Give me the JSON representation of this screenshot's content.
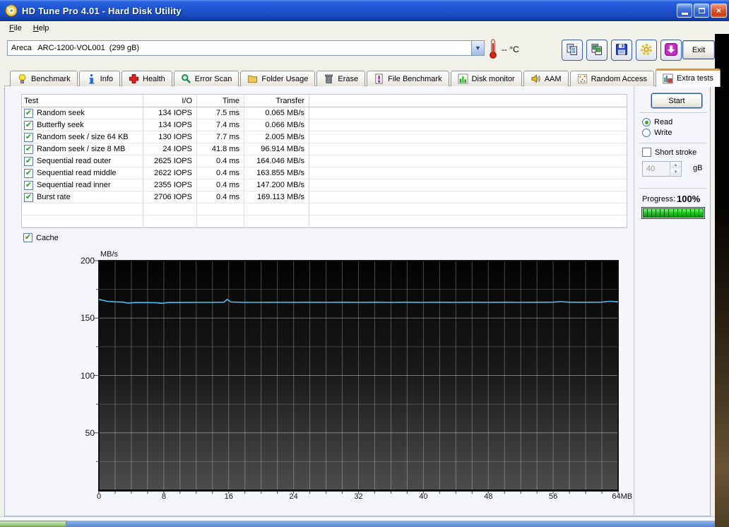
{
  "window": {
    "title": "HD Tune Pro 4.01 - Hard Disk Utility"
  },
  "menu": {
    "items": [
      {
        "label": "File"
      },
      {
        "label": "Help"
      }
    ]
  },
  "toolbar": {
    "drive_selector": {
      "value": "Areca   ARC-1200-VOL001  (299 gB)"
    },
    "temperature": "-- °C",
    "buttons": [
      {
        "icon": "copy-text-icon"
      },
      {
        "icon": "copy-image-icon"
      },
      {
        "icon": "save-icon"
      },
      {
        "icon": "options-icon"
      },
      {
        "icon": "update-icon"
      }
    ],
    "exit_label": "Exit"
  },
  "tabs": {
    "active_index": 10,
    "items": [
      {
        "label": "Benchmark",
        "icon": "benchmark-icon"
      },
      {
        "label": "Info",
        "icon": "info-icon"
      },
      {
        "label": "Health",
        "icon": "health-icon"
      },
      {
        "label": "Error Scan",
        "icon": "error-scan-icon"
      },
      {
        "label": "Folder Usage",
        "icon": "folder-usage-icon"
      },
      {
        "label": "Erase",
        "icon": "erase-icon"
      },
      {
        "label": "File Benchmark",
        "icon": "file-benchmark-icon"
      },
      {
        "label": "Disk monitor",
        "icon": "disk-monitor-icon"
      },
      {
        "label": "AAM",
        "icon": "aam-icon"
      },
      {
        "label": "Random Access",
        "icon": "random-access-icon"
      },
      {
        "label": "Extra tests",
        "icon": "extra-tests-icon"
      }
    ]
  },
  "test_table": {
    "columns": [
      "Test",
      "I/O",
      "Time",
      "Transfer"
    ],
    "empty_rows": 2,
    "rows": [
      {
        "checked": true,
        "test": "Random seek",
        "io": "134 IOPS",
        "time": "7.5 ms",
        "transfer": "0.065 MB/s"
      },
      {
        "checked": true,
        "test": "Butterfly seek",
        "io": "134 IOPS",
        "time": "7.4 ms",
        "transfer": "0.066 MB/s"
      },
      {
        "checked": true,
        "test": "Random seek / size 64 KB",
        "io": "130 IOPS",
        "time": "7.7 ms",
        "transfer": "2.005 MB/s"
      },
      {
        "checked": true,
        "test": "Random seek / size 8 MB",
        "io": "24 IOPS",
        "time": "41.8 ms",
        "transfer": "96.914 MB/s"
      },
      {
        "checked": true,
        "test": "Sequential read outer",
        "io": "2625 IOPS",
        "time": "0.4 ms",
        "transfer": "164.046 MB/s"
      },
      {
        "checked": true,
        "test": "Sequential read middle",
        "io": "2622 IOPS",
        "time": "0.4 ms",
        "transfer": "163.855 MB/s"
      },
      {
        "checked": true,
        "test": "Sequential read inner",
        "io": "2355 IOPS",
        "time": "0.4 ms",
        "transfer": "147.200 MB/s"
      },
      {
        "checked": true,
        "test": "Burst rate",
        "io": "2706 IOPS",
        "time": "0.4 ms",
        "transfer": "169.113 MB/s"
      }
    ]
  },
  "controls": {
    "start_label": "Start",
    "read_label": "Read",
    "write_label": "Write",
    "read_selected": true,
    "short_stroke_label": "Short stroke",
    "short_stroke_checked": false,
    "size_value": "40",
    "size_unit": "gB",
    "progress_label": "Progress:",
    "progress_value": "100%",
    "progress_percent": 100,
    "progress_segments": 14
  },
  "cache": {
    "label": "Cache",
    "checked": true
  },
  "chart_data": {
    "type": "line",
    "title": "",
    "xlabel": "MB",
    "ylabel": "MB/s",
    "xlim": [
      0,
      64
    ],
    "ylim": [
      0,
      200
    ],
    "x_ticks": [
      0,
      8,
      16,
      24,
      32,
      40,
      48,
      56,
      64
    ],
    "x_tick_labels": [
      "0",
      "8",
      "16",
      "24",
      "32",
      "40",
      "48",
      "56",
      "64MB"
    ],
    "y_ticks": [
      50,
      100,
      150,
      200
    ],
    "grid": {
      "on": true,
      "x_minor_step": 2,
      "y_minor_step": 25
    },
    "legend_position": "none",
    "series": [
      {
        "name": "Cache",
        "color": "#4fc0ee",
        "points": [
          [
            0,
            166.3
          ],
          [
            1,
            164.6
          ],
          [
            2,
            164.1
          ],
          [
            3,
            163.9
          ],
          [
            3.6,
            163.0
          ],
          [
            4.5,
            163.6
          ],
          [
            6,
            163.5
          ],
          [
            7.2,
            163.3
          ],
          [
            7.8,
            162.9
          ],
          [
            8.5,
            163.6
          ],
          [
            10,
            163.6
          ],
          [
            12,
            163.7
          ],
          [
            14,
            163.7
          ],
          [
            15.4,
            163.8
          ],
          [
            15.8,
            166.2
          ],
          [
            16.3,
            164.0
          ],
          [
            18,
            163.7
          ],
          [
            20,
            163.7
          ],
          [
            22,
            163.8
          ],
          [
            24,
            163.7
          ],
          [
            26,
            163.8
          ],
          [
            28,
            163.7
          ],
          [
            30,
            163.8
          ],
          [
            32,
            163.7
          ],
          [
            34,
            163.8
          ],
          [
            36,
            163.7
          ],
          [
            38,
            163.8
          ],
          [
            40,
            163.7
          ],
          [
            42,
            163.8
          ],
          [
            44,
            163.7
          ],
          [
            46,
            163.8
          ],
          [
            48,
            163.7
          ],
          [
            50,
            163.8
          ],
          [
            52,
            163.7
          ],
          [
            54,
            163.8
          ],
          [
            56,
            163.9
          ],
          [
            57,
            164.3
          ],
          [
            58,
            163.8
          ],
          [
            60,
            163.8
          ],
          [
            62,
            163.9
          ],
          [
            63,
            164.6
          ],
          [
            64,
            164.1
          ]
        ]
      }
    ]
  },
  "colors": {
    "titlebar_blue": "#1e54d0",
    "tab_active_orange": "#e8952e",
    "progress_green": "#22cc22",
    "chart_line_cyan": "#4fc0ee",
    "chart_bg_top": "#030303",
    "chart_bg_bottom": "#4d4d4d",
    "taskbar_blue": "#6a97dd",
    "taskbar_green": "#a8cf8e",
    "close_button_red": "#cc3c14"
  }
}
